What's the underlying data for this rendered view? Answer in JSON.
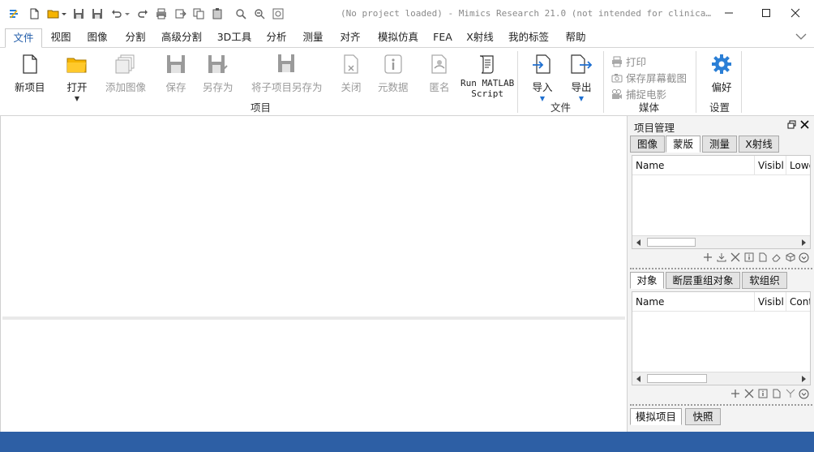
{
  "window": {
    "title": "(No project loaded) - Mimics Research 21.0 (not intended for clinica…",
    "minimize_icon": "minimize-icon",
    "maximize_icon": "maximize-icon",
    "close_icon": "close-icon"
  },
  "quick_access": [
    "app-logo-icon",
    "new-icon",
    "open-folder-icon",
    "save-icon",
    "save-as-icon",
    "undo-icon",
    "redo-icon",
    "print-icon",
    "export-icon",
    "copy-icon",
    "paste-icon",
    "zoom-icon",
    "zoom-out-icon",
    "fit-icon"
  ],
  "menu_tabs": [
    "文件",
    "视图",
    "图像",
    "分割",
    "高级分割",
    "3D工具",
    "分析",
    "测量",
    "对齐",
    "模拟仿真",
    "FEA",
    "X射线",
    "我的标签",
    "帮助"
  ],
  "active_tab": "文件",
  "ribbon": {
    "buttons": {
      "new_project": "新项目",
      "open": "打开",
      "add_images": "添加图像",
      "save": "保存",
      "save_as": "另存为",
      "save_project_as": "将子项目另存为",
      "close": "关闭",
      "metadata": "元数据",
      "anonymize": "匿名",
      "run_matlab": "Run MATLAB",
      "run_matlab_2": "Script",
      "import": "导入",
      "export": "导出",
      "preferences": "偏好"
    },
    "media": {
      "print": "打印",
      "screenshot": "保存屏幕截图",
      "capture_movie": "捕捉电影"
    },
    "groups": {
      "project": "项目",
      "file": "文件",
      "media": "媒体",
      "settings": "设置"
    }
  },
  "panel": {
    "title": "项目管理",
    "top_tabs": [
      "图像",
      "蒙版",
      "测量",
      "X射线"
    ],
    "top_active": "蒙版",
    "top_columns": [
      "Name",
      "Visibl",
      "Lowe"
    ],
    "mid_tabs": [
      "对象",
      "断层重组对象",
      "软组织"
    ],
    "mid_active": "对象",
    "mid_columns": [
      "Name",
      "Visibl",
      "Cont"
    ],
    "bottom_tabs": [
      "模拟项目",
      "快照"
    ],
    "bottom_active": "模拟项目"
  },
  "colors": {
    "statusbar": "#2d5fa5",
    "accent": "#1e5aa8",
    "folder": "#f5b400",
    "gear": "#2b7fd6"
  }
}
